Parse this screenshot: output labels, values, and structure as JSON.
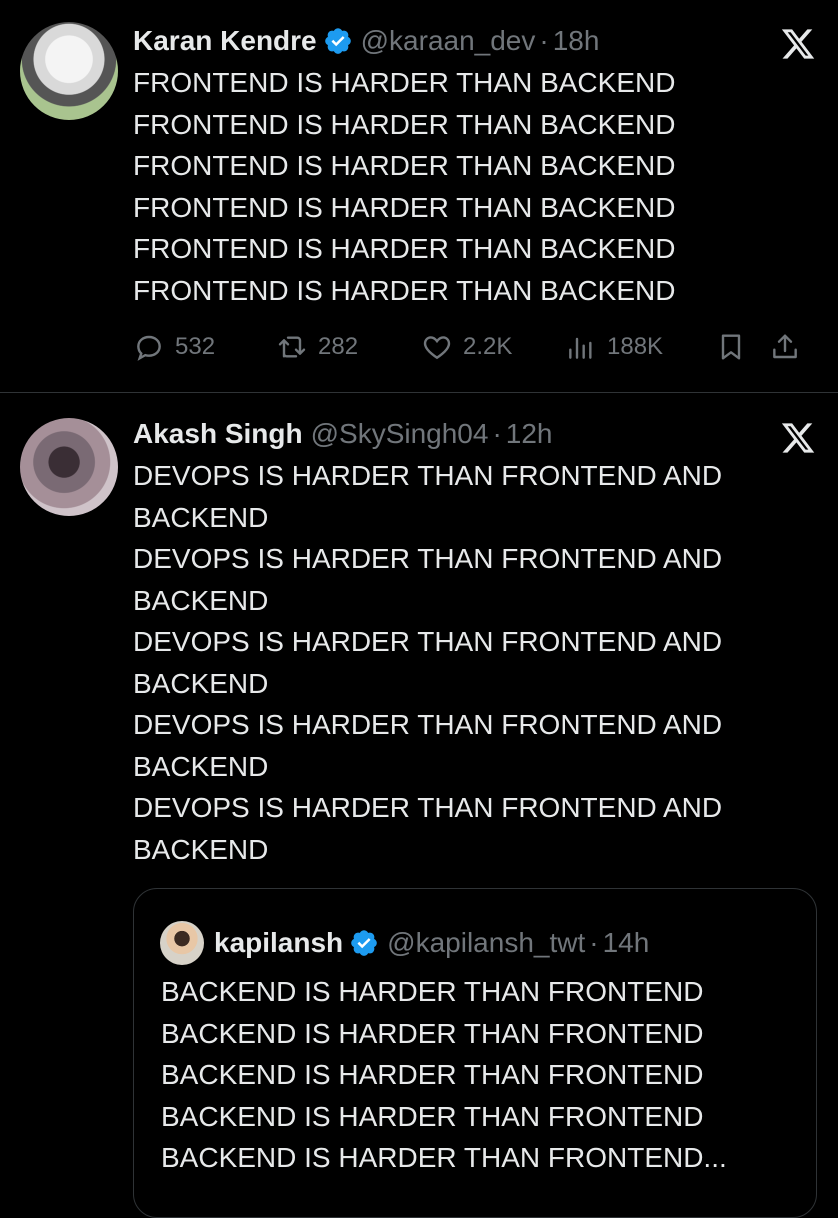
{
  "tweets": [
    {
      "name": "Karan Kendre",
      "verified": true,
      "handle": "@karaan_dev",
      "separator": "·",
      "time": "18h",
      "lines": [
        "FRONTEND IS HARDER THAN BACKEND",
        "FRONTEND IS HARDER THAN BACKEND",
        "FRONTEND IS HARDER THAN BACKEND",
        "FRONTEND IS HARDER THAN BACKEND",
        "FRONTEND IS HARDER THAN BACKEND",
        "FRONTEND IS HARDER THAN BACKEND"
      ],
      "stats": {
        "replies": "532",
        "retweets": "282",
        "likes": "2.2K",
        "views": "188K"
      }
    },
    {
      "name": "Akash Singh",
      "verified": false,
      "handle": "@SkySingh04",
      "separator": "·",
      "time": "12h",
      "lines": [
        "DEVOPS IS HARDER THAN FRONTEND AND BACKEND",
        "DEVOPS IS HARDER THAN FRONTEND AND BACKEND",
        "DEVOPS IS HARDER THAN FRONTEND AND BACKEND",
        "DEVOPS IS HARDER THAN FRONTEND AND BACKEND",
        "DEVOPS IS HARDER THAN FRONTEND AND BACKEND"
      ],
      "quote": {
        "name": "kapilansh",
        "verified": true,
        "handle": "@kapilansh_twt",
        "separator": "·",
        "time": "14h",
        "lines": [
          "BACKEND IS HARDER THAN FRONTEND",
          "BACKEND IS HARDER THAN FRONTEND",
          "BACKEND IS HARDER THAN FRONTEND",
          "BACKEND IS HARDER THAN FRONTEND",
          "BACKEND IS HARDER THAN FRONTEND..."
        ]
      }
    }
  ],
  "icons": {
    "platform": "x-logo-icon",
    "verified": "verified-badge-icon",
    "reply": "reply-icon",
    "retweet": "retweet-icon",
    "like": "heart-icon",
    "views": "views-icon",
    "bookmark": "bookmark-icon",
    "share": "share-icon"
  },
  "colors": {
    "background": "#000000",
    "text": "#e7e9ea",
    "muted": "#71767b",
    "verified": "#1d9bf0",
    "border": "#2f3336"
  }
}
